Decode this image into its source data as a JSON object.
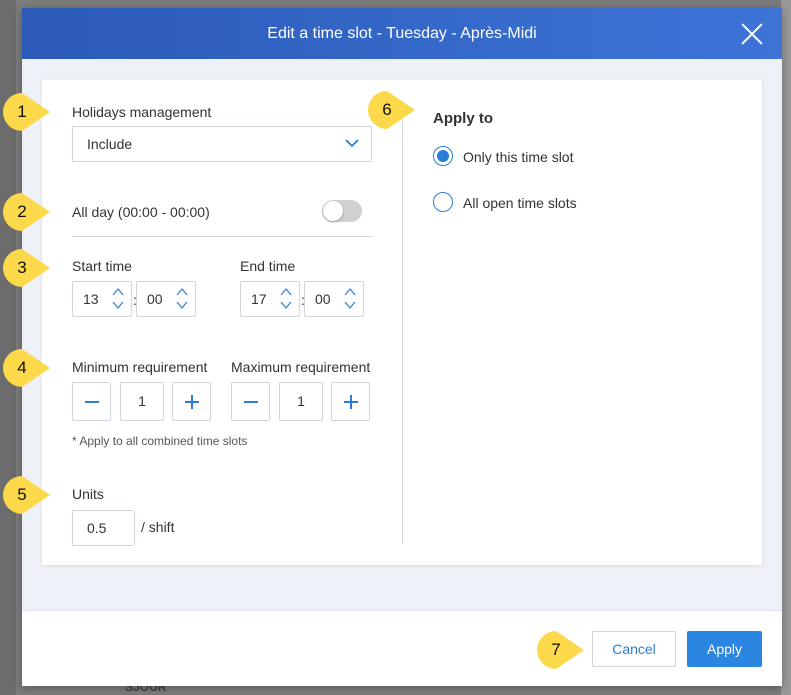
{
  "dialog": {
    "title": "Edit a time slot - Tuesday - Après-Midi"
  },
  "holidays": {
    "label": "Holidays management",
    "value": "Include"
  },
  "all_day": {
    "label": "All day (00:00 - 00:00)",
    "enabled": false
  },
  "start_time": {
    "label": "Start time",
    "hour": "13",
    "minute": "00",
    "separator": ":"
  },
  "end_time": {
    "label": "End time",
    "hour": "17",
    "minute": "00",
    "separator": ":"
  },
  "minimum": {
    "label": "Minimum requirement",
    "value": "1"
  },
  "maximum": {
    "label": "Maximum requirement",
    "value": "1"
  },
  "requirement_note": "* Apply to all combined time slots",
  "units": {
    "label": "Units",
    "value": "0.5",
    "suffix": "/ shift"
  },
  "apply_to": {
    "title": "Apply to",
    "options": [
      {
        "label": "Only this time slot",
        "checked": true
      },
      {
        "label": "All open time slots",
        "checked": false
      }
    ]
  },
  "footer": {
    "cancel_label": "Cancel",
    "apply_label": "Apply"
  },
  "callouts": [
    "1",
    "2",
    "3",
    "4",
    "5",
    "6",
    "7"
  ],
  "background": {
    "partial_text": "SJOUR"
  },
  "colors": {
    "header_start": "#2b5ab8",
    "header_end": "#3d74d6",
    "accent": "#2a86e0",
    "callout": "#fcd94a"
  }
}
